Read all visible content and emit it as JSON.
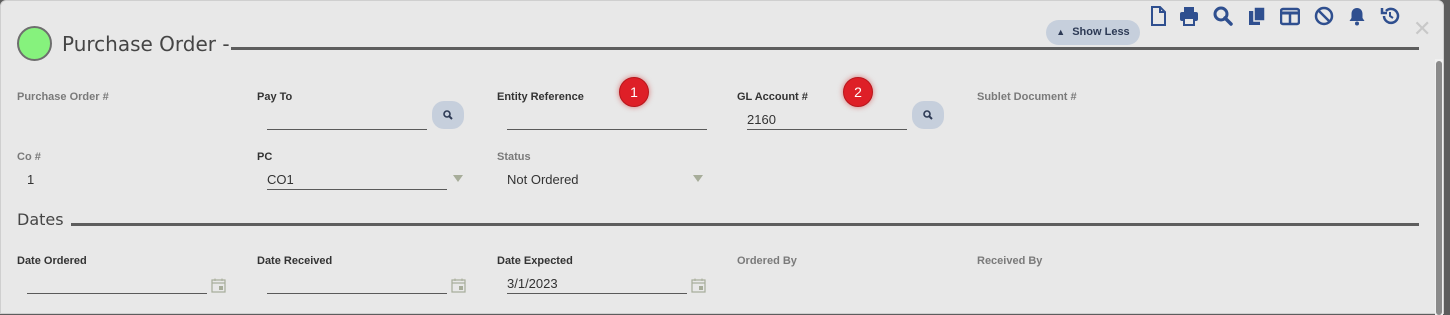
{
  "header": {
    "title": "Purchase Order -",
    "status_color": "#86f27d",
    "show_less_label": "Show Less",
    "toolbar_icons": [
      "new-document-icon",
      "print-icon",
      "search-icon",
      "copy-icon",
      "columns-icon",
      "cancel-icon",
      "bell-icon",
      "history-icon"
    ],
    "close_label": "✕"
  },
  "fields": {
    "purchase_order_no": {
      "label": "Purchase Order #",
      "value": ""
    },
    "pay_to": {
      "label": "Pay To",
      "value": ""
    },
    "entity_reference": {
      "label": "Entity Reference",
      "value": "",
      "badge": "1"
    },
    "gl_account": {
      "label": "GL Account #",
      "value": "2160",
      "badge": "2"
    },
    "sublet_document": {
      "label": "Sublet Document #",
      "value": ""
    },
    "co_no": {
      "label": "Co #",
      "value": "1"
    },
    "pc": {
      "label": "PC",
      "value": "CO1"
    },
    "status": {
      "label": "Status",
      "value": "Not Ordered"
    }
  },
  "dates": {
    "section_title": "Dates",
    "date_ordered": {
      "label": "Date Ordered",
      "value": ""
    },
    "date_received": {
      "label": "Date Received",
      "value": ""
    },
    "date_expected": {
      "label": "Date Expected",
      "value": "3/1/2023"
    },
    "ordered_by": {
      "label": "Ordered By",
      "value": ""
    },
    "received_by": {
      "label": "Received By",
      "value": ""
    }
  },
  "colors": {
    "accent_button": "#c6cfdc",
    "icon_blue": "#2f4f8f",
    "badge_red": "#de1f27"
  }
}
